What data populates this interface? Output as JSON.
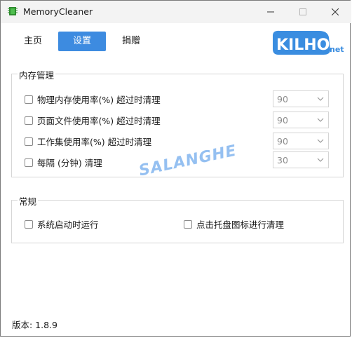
{
  "app": {
    "title": "MemoryCleaner"
  },
  "nav": {
    "tabs": [
      {
        "label": "主页"
      },
      {
        "label": "设置"
      },
      {
        "label": "捐赠"
      }
    ]
  },
  "logo": {
    "text_main": "KILHO",
    "text_sub": "net"
  },
  "memory_group": {
    "title": "内存管理",
    "rows": [
      {
        "label": "物理内存使用率(%) 超过时清理",
        "value": "90"
      },
      {
        "label": "页面文件使用率(%) 超过时清理",
        "value": "90"
      },
      {
        "label": "工作集使用率(%) 超过时清理",
        "value": "90"
      },
      {
        "label": "每隔 (分钟) 清理",
        "value": "30"
      }
    ]
  },
  "general_group": {
    "title": "常规",
    "options": [
      {
        "label": "系统启动时运行"
      },
      {
        "label": "点击托盘图标进行清理"
      }
    ]
  },
  "watermark": "SALANGHE",
  "version": "版本: 1.8.9",
  "colors": {
    "accent": "#3d8be0",
    "logo_blue": "#3a8de0"
  }
}
